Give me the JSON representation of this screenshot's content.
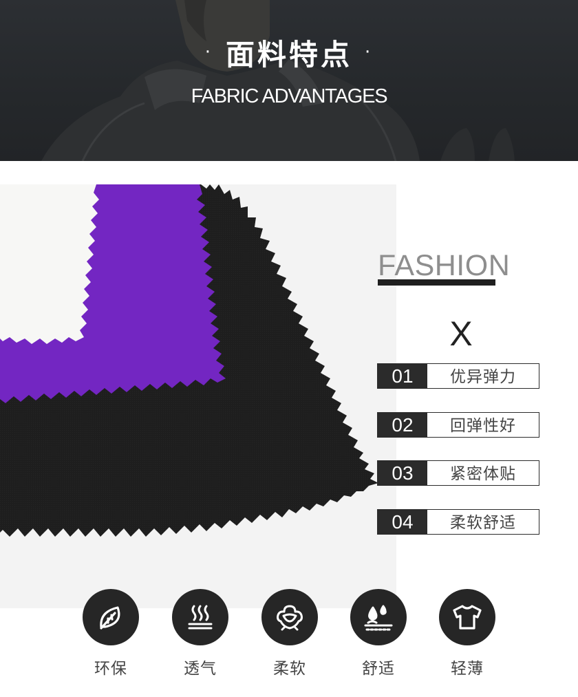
{
  "header": {
    "title": "面料特点",
    "title_bullet": "·",
    "subtitle": "FABRIC ADVANTAGES"
  },
  "swatches": {
    "colors": [
      "#f7f7f5",
      "#7326c2",
      "#1e1e1e"
    ]
  },
  "fashion": {
    "word": "FASHION",
    "separator": "X"
  },
  "features": [
    {
      "num": "01",
      "label": "优异弹力"
    },
    {
      "num": "02",
      "label": "回弹性好"
    },
    {
      "num": "03",
      "label": "紧密体贴"
    },
    {
      "num": "04",
      "label": "柔软舒适"
    }
  ],
  "icons": [
    {
      "icon": "leaf-icon",
      "label": "环保"
    },
    {
      "icon": "steam-icon",
      "label": "透气"
    },
    {
      "icon": "cotton-icon",
      "label": "柔软"
    },
    {
      "icon": "water-drop-icon",
      "label": "舒适"
    },
    {
      "icon": "tshirt-icon",
      "label": "轻薄"
    }
  ]
}
